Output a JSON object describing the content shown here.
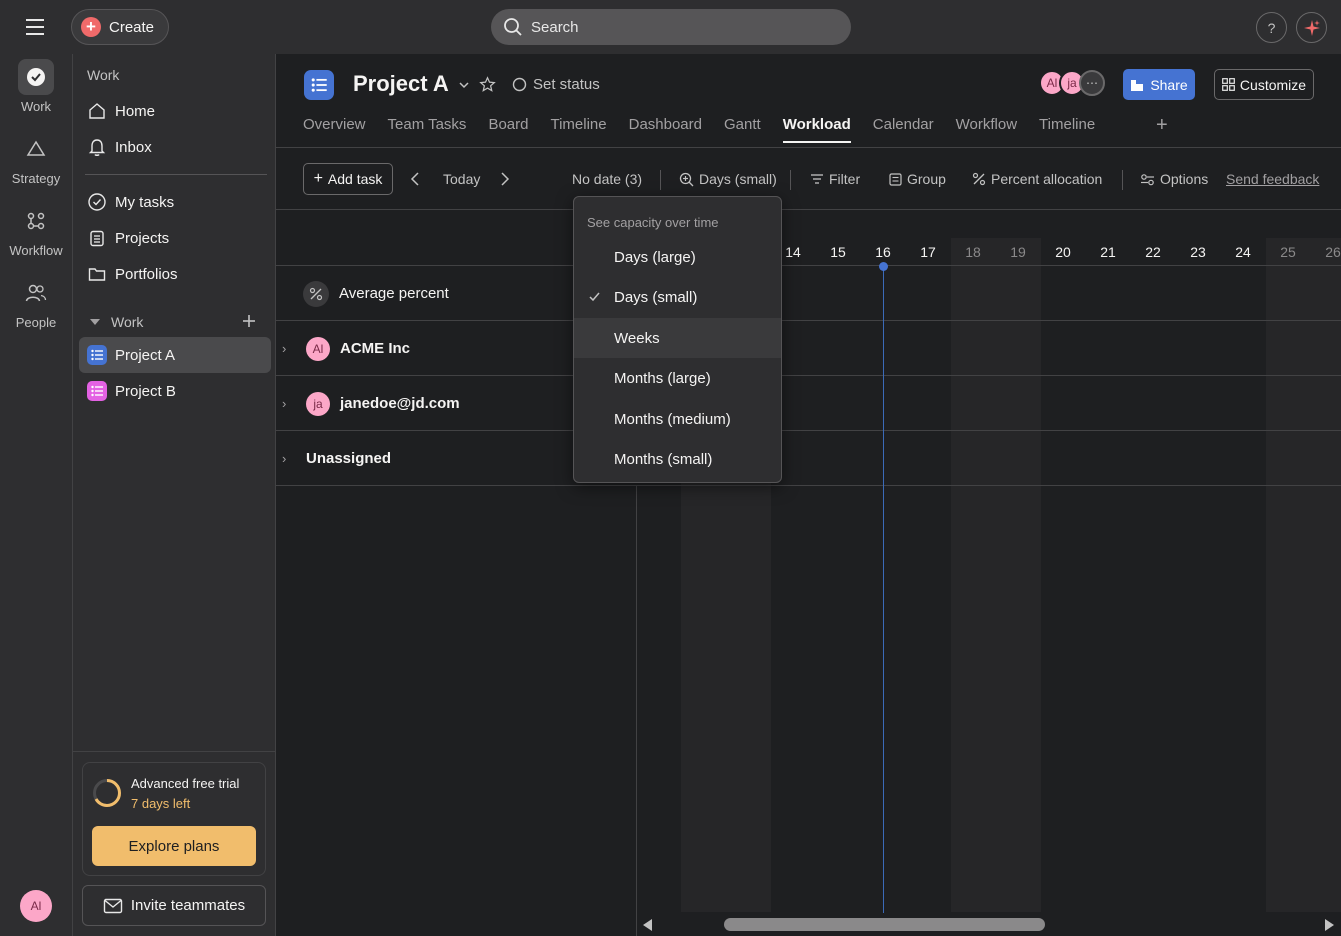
{
  "topbar": {
    "create_label": "Create",
    "search_placeholder": "Search",
    "help_label": "?"
  },
  "rail": {
    "items": [
      {
        "label": "Work"
      },
      {
        "label": "Strategy"
      },
      {
        "label": "Workflow"
      },
      {
        "label": "People"
      }
    ],
    "user_initials": "Al"
  },
  "sidebar": {
    "section_work_heading": "Work",
    "home": "Home",
    "inbox": "Inbox",
    "my_tasks": "My tasks",
    "projects": "Projects",
    "portfolios": "Portfolios",
    "team_heading": "Work",
    "projects_list": [
      {
        "name": "Project A",
        "color": "#4573d2"
      },
      {
        "name": "Project B",
        "color": "#e362e3"
      }
    ],
    "trial": {
      "title": "Advanced free trial",
      "days_left": "7 days left",
      "explore_label": "Explore plans"
    },
    "invite_label": "Invite teammates"
  },
  "header": {
    "project_title": "Project A",
    "set_status": "Set status",
    "members": [
      {
        "initials": "Al",
        "color": "#fca7c8"
      },
      {
        "initials": "ja",
        "color": "#fca7c8"
      }
    ],
    "share_label": "Share",
    "customize_label": "Customize",
    "tabs": [
      {
        "label": "Overview",
        "active": false
      },
      {
        "label": "Team Tasks",
        "active": false
      },
      {
        "label": "Board",
        "active": false
      },
      {
        "label": "Timeline",
        "active": false
      },
      {
        "label": "Dashboard",
        "active": false
      },
      {
        "label": "Gantt",
        "active": false
      },
      {
        "label": "Workload",
        "active": true
      },
      {
        "label": "Calendar",
        "active": false
      },
      {
        "label": "Workflow",
        "active": false
      },
      {
        "label": "Timeline",
        "active": false
      }
    ]
  },
  "toolbar": {
    "add_task": "Add task",
    "today": "Today",
    "no_date": "No date (3)",
    "zoom": "Days (small)",
    "filter": "Filter",
    "group": "Group",
    "percent": "Percent allocation",
    "options": "Options",
    "feedback": "Send feedback"
  },
  "workload": {
    "rows": [
      {
        "label": "Average percent",
        "kind": "average"
      },
      {
        "label": "ACME Inc",
        "kind": "assignee",
        "initials": "Al"
      },
      {
        "label": "janedoe@jd.com",
        "kind": "assignee",
        "initials": "ja"
      },
      {
        "label": "Unassigned",
        "kind": "unassigned"
      }
    ],
    "days": [
      {
        "n": "14",
        "weekend": false
      },
      {
        "n": "15",
        "weekend": false
      },
      {
        "n": "16",
        "weekend": false,
        "today": true
      },
      {
        "n": "17",
        "weekend": false
      },
      {
        "n": "18",
        "weekend": true
      },
      {
        "n": "19",
        "weekend": true
      },
      {
        "n": "20",
        "weekend": false
      },
      {
        "n": "21",
        "weekend": false
      },
      {
        "n": "22",
        "weekend": false
      },
      {
        "n": "23",
        "weekend": false
      },
      {
        "n": "24",
        "weekend": false
      },
      {
        "n": "25",
        "weekend": true
      },
      {
        "n": "26",
        "weekend": true
      }
    ]
  },
  "dropdown": {
    "heading": "See capacity over time",
    "selected": "Days (small)",
    "hovered": "Weeks",
    "options": [
      "Days (large)",
      "Days (small)",
      "Weeks",
      "Months (large)",
      "Months (medium)",
      "Months (small)"
    ]
  },
  "colors": {
    "accent": "#4573d2",
    "create": "#f06a6a",
    "trial": "#f1bd6c"
  }
}
